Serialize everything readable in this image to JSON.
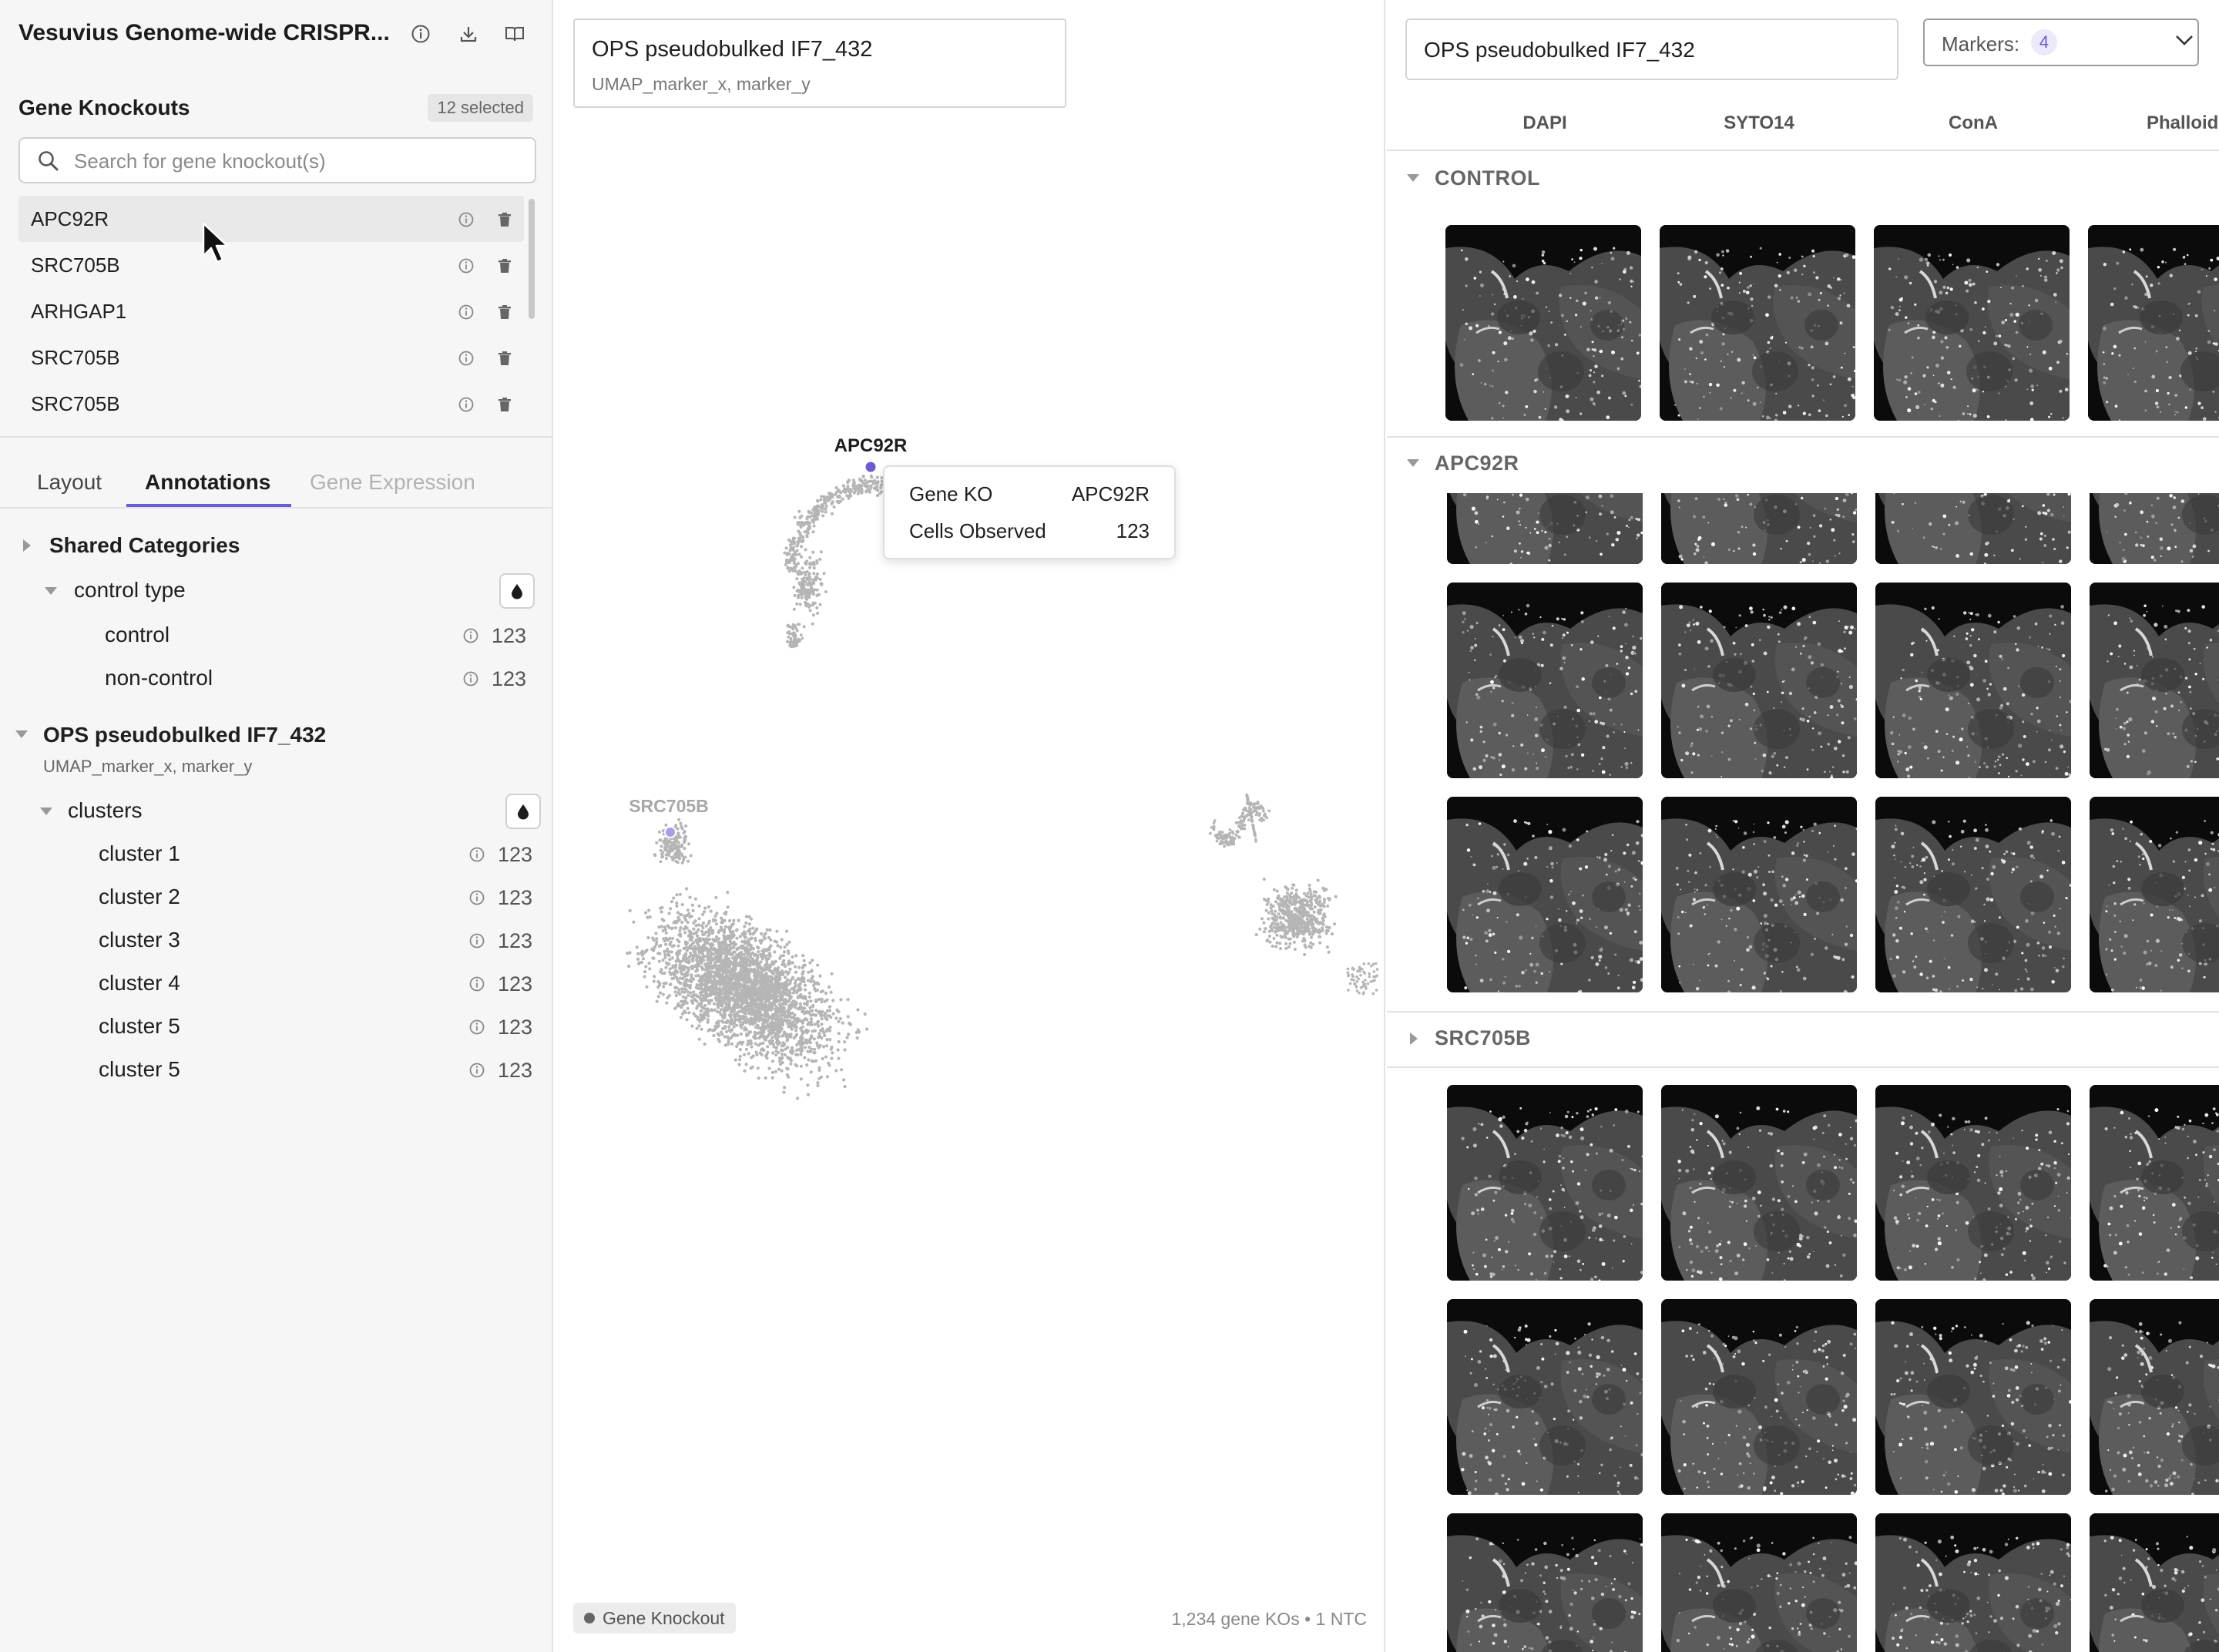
{
  "app": {
    "title": "Vesuvius Genome-wide CRISPR..."
  },
  "sidebar": {
    "section_title": "Gene Knockouts",
    "selected_badge": "12 selected",
    "search_placeholder": "Search for gene knockout(s)",
    "knockouts": [
      {
        "label": "APC92R"
      },
      {
        "label": "SRC705B"
      },
      {
        "label": "ARHGAP1"
      },
      {
        "label": "SRC705B"
      },
      {
        "label": "SRC705B"
      }
    ],
    "tabs": [
      {
        "label": "Layout"
      },
      {
        "label": "Annotations"
      },
      {
        "label": "Gene Expression"
      }
    ],
    "active_tab": "Annotations",
    "shared_categories": "Shared Categories",
    "control_type": {
      "label": "control type",
      "items": [
        {
          "label": "control",
          "count": "123"
        },
        {
          "label": "non-control",
          "count": "123"
        }
      ]
    },
    "embedding": {
      "title": "OPS pseudobulked IF7_432",
      "subtitle": "UMAP_marker_x, marker_y",
      "clusters_label": "clusters",
      "clusters": [
        {
          "label": "cluster 1",
          "count": "123"
        },
        {
          "label": "cluster 2",
          "count": "123"
        },
        {
          "label": "cluster 3",
          "count": "123"
        },
        {
          "label": "cluster 4",
          "count": "123"
        },
        {
          "label": "cluster 5",
          "count": "123"
        },
        {
          "label": "cluster 5",
          "count": "123"
        }
      ]
    }
  },
  "plot": {
    "card_title": "OPS pseudobulked IF7_432",
    "card_subtitle": "UMAP_marker_x, marker_y",
    "labels": {
      "highlight": "APC92R",
      "secondary": "SRC705B"
    },
    "tooltip": {
      "row1_key": "Gene KO",
      "row1_value": "APC92R",
      "row2_key": "Cells Observed",
      "row2_value": "123"
    },
    "legend_label": "Gene Knockout",
    "footer": "1,234 gene KOs • 1 NTC",
    "colors": {
      "points": "#b5b5b5",
      "highlight": "#6b5bd6"
    }
  },
  "images_panel": {
    "dataset_value": "OPS pseudobulked IF7_432",
    "markers_label": "Markers:",
    "markers_count": "4",
    "columns": [
      "DAPI",
      "SYTO14",
      "ConA",
      "Phalloidin"
    ],
    "groups": [
      {
        "name": "CONTROL",
        "expanded": true
      },
      {
        "name": "APC92R",
        "expanded": true
      },
      {
        "name": "SRC705B",
        "expanded": false
      }
    ]
  }
}
